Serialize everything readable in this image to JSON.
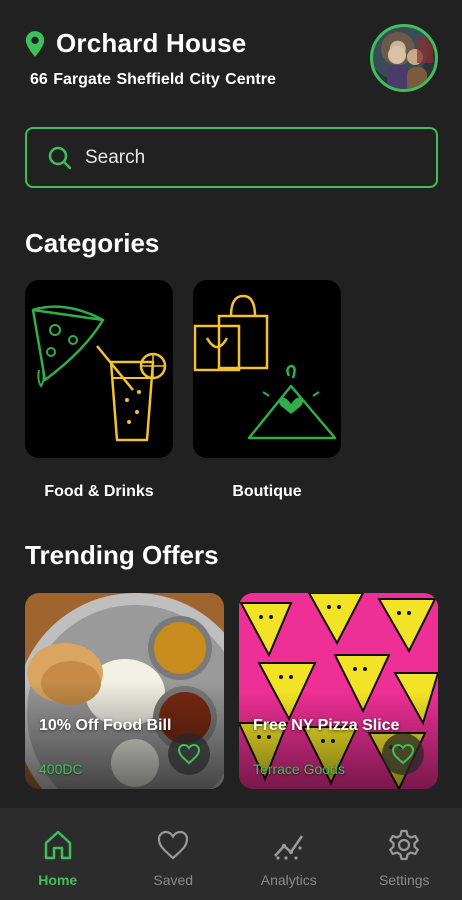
{
  "header": {
    "location_name": "Orchard House",
    "address": "66 Fargate  Sheffield City Centre",
    "avatar_icon": "user-avatar"
  },
  "search": {
    "placeholder": "Search"
  },
  "categories": {
    "title": "Categories",
    "items": [
      {
        "label": "Food & Drinks",
        "icon": "pizza-drink-illustration"
      },
      {
        "label": "Boutique",
        "icon": "shopping-bag-hanger-illustration"
      }
    ]
  },
  "trending": {
    "title": "Trending Offers",
    "items": [
      {
        "title": "10% Off Food Bill",
        "vendor": "400DC"
      },
      {
        "title": "Free NY Pizza Slice",
        "vendor": "Terrace Goods"
      }
    ]
  },
  "nav": {
    "items": [
      {
        "label": "Home",
        "icon": "home-icon",
        "active": true
      },
      {
        "label": "Saved",
        "icon": "heart-icon",
        "active": false
      },
      {
        "label": "Analytics",
        "icon": "analytics-icon",
        "active": false
      },
      {
        "label": "Settings",
        "icon": "gear-icon",
        "active": false
      }
    ]
  },
  "colors": {
    "accent": "#3fbf5c",
    "background": "#212121",
    "yellow": "#f2c230",
    "pink": "#ee2f95"
  }
}
